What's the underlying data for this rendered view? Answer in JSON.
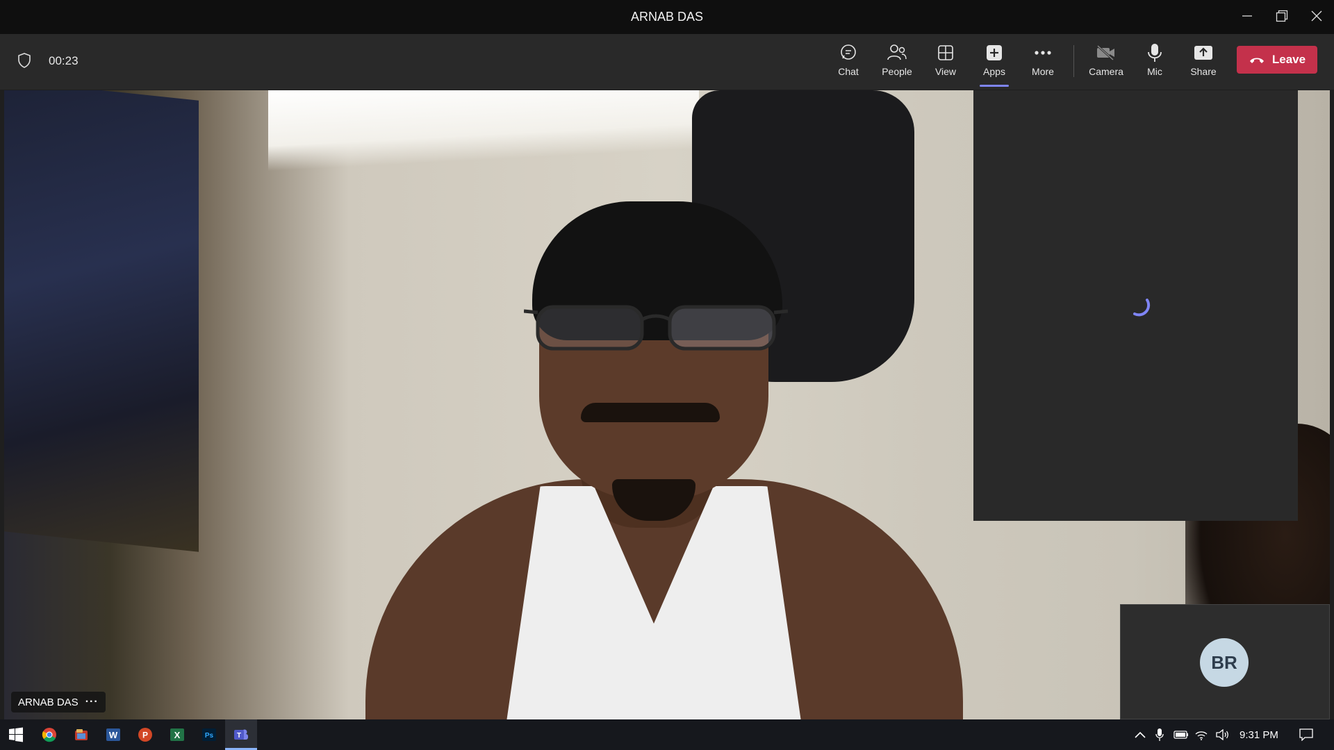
{
  "window": {
    "title": "ARNAB DAS",
    "controls": [
      "minimize-icon",
      "restore-icon",
      "close-icon"
    ]
  },
  "meeting": {
    "timer": "00:23",
    "toolbar": [
      {
        "id": "chat",
        "label": "Chat",
        "icon": "chat-icon"
      },
      {
        "id": "people",
        "label": "People",
        "icon": "people-icon"
      },
      {
        "id": "view",
        "label": "View",
        "icon": "view-grid-icon"
      },
      {
        "id": "apps",
        "label": "Apps",
        "icon": "apps-plus-icon",
        "active": true
      },
      {
        "id": "more",
        "label": "More",
        "icon": "more-dots-icon"
      },
      {
        "id": "camera",
        "label": "Camera",
        "icon": "camera-off-icon"
      },
      {
        "id": "mic",
        "label": "Mic",
        "icon": "mic-icon"
      },
      {
        "id": "share",
        "label": "Share",
        "icon": "share-icon"
      }
    ],
    "leave_label": "Leave",
    "colors": {
      "leave": "#c4314b",
      "accent": "#7f85f5"
    }
  },
  "stage": {
    "speaker_name": "ARNAB DAS",
    "participant_initials": "BR"
  },
  "taskbar": {
    "apps": [
      "windows-start-icon",
      "chrome-icon",
      "file-manager-icon",
      "word-icon",
      "powerpoint-icon",
      "excel-icon",
      "photoshop-icon",
      "teams-icon"
    ],
    "clock": "9:31 PM"
  }
}
